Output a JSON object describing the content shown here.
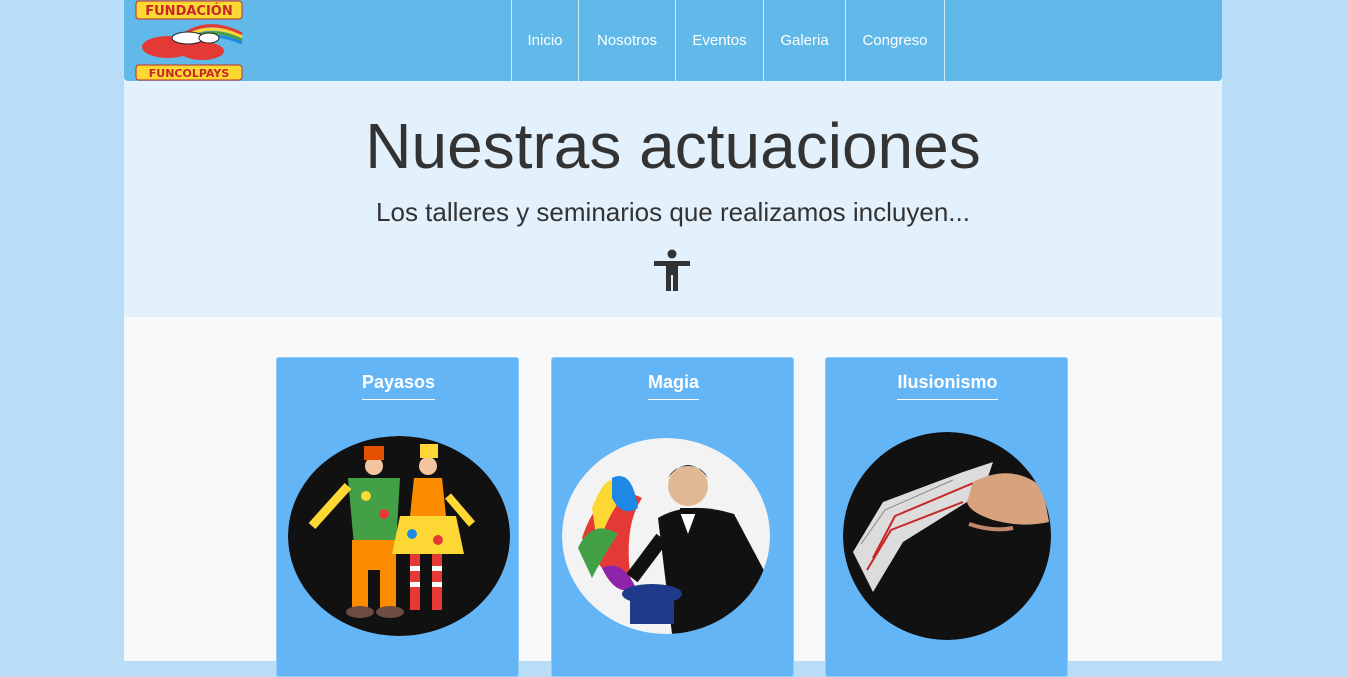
{
  "brand": {
    "logo_top": "FUNDACIÓN",
    "logo_bottom": "FUNCOLPAYS"
  },
  "nav": {
    "items": [
      {
        "label": "Inicio"
      },
      {
        "label": "Nosotros"
      },
      {
        "label": "Eventos"
      },
      {
        "label": "Galeria"
      },
      {
        "label": "Congreso"
      }
    ]
  },
  "hero": {
    "title": "Nuestras actuaciones",
    "subtitle": "Los talleres y seminarios que realizamos incluyen...",
    "icon": "person-accessibility-icon"
  },
  "cards": [
    {
      "title": "Payasos",
      "image": "clowns-image"
    },
    {
      "title": "Magia",
      "image": "magician-image"
    },
    {
      "title": "Ilusionismo",
      "image": "card-trick-image"
    }
  ],
  "colors": {
    "navbar": "#61b9ea",
    "hero_bg": "#e3f1fc",
    "card_bg": "#64b5f6",
    "outer_bg": "#b9dcf7"
  }
}
